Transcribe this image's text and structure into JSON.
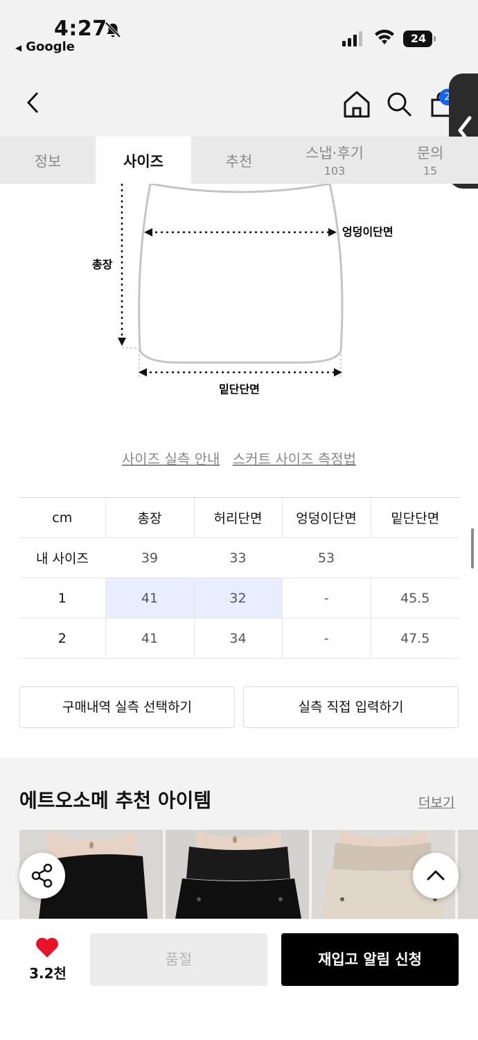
{
  "status_bar": {
    "time": "4:27",
    "back_app": "Google",
    "battery": "24"
  },
  "nav": {
    "cart_badge": "2"
  },
  "tabs": [
    {
      "label": "정보",
      "count": ""
    },
    {
      "label": "사이즈",
      "count": ""
    },
    {
      "label": "추천",
      "count": ""
    },
    {
      "label": "스냅·후기",
      "count": "103"
    },
    {
      "label": "문의",
      "count": "15"
    }
  ],
  "diagram": {
    "length_label": "총장",
    "hip_label": "엉덩이단면",
    "hem_label": "밑단단면"
  },
  "links": {
    "size_guide": "사이즈 실측 안내",
    "measure_guide": "스커트 사이즈 측정법"
  },
  "size_table": {
    "headers": [
      "cm",
      "총장",
      "허리단면",
      "엉덩이단면",
      "밑단단면"
    ],
    "rows": [
      [
        "내 사이즈",
        "39",
        "33",
        "53",
        ""
      ],
      [
        "1",
        "41",
        "32",
        "-",
        "45.5"
      ],
      [
        "2",
        "41",
        "34",
        "-",
        "47.5"
      ]
    ]
  },
  "actions": {
    "purchase_history": "구매내역 실측 선택하기",
    "manual_input": "실측 직접 입력하기"
  },
  "recommend": {
    "title": "에트오소메 추천 아이템",
    "more": "더보기"
  },
  "bottom": {
    "like_count": "3.2천",
    "soldout": "품절",
    "notify": "재입고 알림 신청"
  },
  "colors": {
    "accent_blue": "#1464f4",
    "highlight": "#e8eeff",
    "heart": "#e8132b"
  }
}
